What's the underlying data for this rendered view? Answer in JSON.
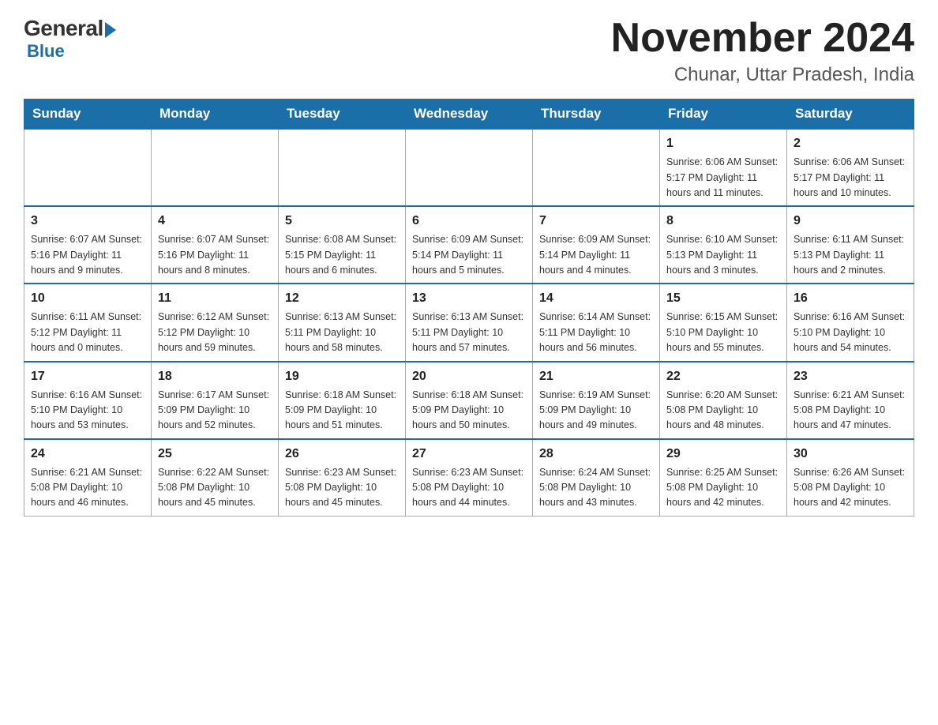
{
  "header": {
    "logo_general": "General",
    "logo_blue": "Blue",
    "month_title": "November 2024",
    "location": "Chunar, Uttar Pradesh, India"
  },
  "days_of_week": [
    "Sunday",
    "Monday",
    "Tuesday",
    "Wednesday",
    "Thursday",
    "Friday",
    "Saturday"
  ],
  "weeks": [
    [
      {
        "day": "",
        "info": ""
      },
      {
        "day": "",
        "info": ""
      },
      {
        "day": "",
        "info": ""
      },
      {
        "day": "",
        "info": ""
      },
      {
        "day": "",
        "info": ""
      },
      {
        "day": "1",
        "info": "Sunrise: 6:06 AM\nSunset: 5:17 PM\nDaylight: 11 hours\nand 11 minutes."
      },
      {
        "day": "2",
        "info": "Sunrise: 6:06 AM\nSunset: 5:17 PM\nDaylight: 11 hours\nand 10 minutes."
      }
    ],
    [
      {
        "day": "3",
        "info": "Sunrise: 6:07 AM\nSunset: 5:16 PM\nDaylight: 11 hours\nand 9 minutes."
      },
      {
        "day": "4",
        "info": "Sunrise: 6:07 AM\nSunset: 5:16 PM\nDaylight: 11 hours\nand 8 minutes."
      },
      {
        "day": "5",
        "info": "Sunrise: 6:08 AM\nSunset: 5:15 PM\nDaylight: 11 hours\nand 6 minutes."
      },
      {
        "day": "6",
        "info": "Sunrise: 6:09 AM\nSunset: 5:14 PM\nDaylight: 11 hours\nand 5 minutes."
      },
      {
        "day": "7",
        "info": "Sunrise: 6:09 AM\nSunset: 5:14 PM\nDaylight: 11 hours\nand 4 minutes."
      },
      {
        "day": "8",
        "info": "Sunrise: 6:10 AM\nSunset: 5:13 PM\nDaylight: 11 hours\nand 3 minutes."
      },
      {
        "day": "9",
        "info": "Sunrise: 6:11 AM\nSunset: 5:13 PM\nDaylight: 11 hours\nand 2 minutes."
      }
    ],
    [
      {
        "day": "10",
        "info": "Sunrise: 6:11 AM\nSunset: 5:12 PM\nDaylight: 11 hours\nand 0 minutes."
      },
      {
        "day": "11",
        "info": "Sunrise: 6:12 AM\nSunset: 5:12 PM\nDaylight: 10 hours\nand 59 minutes."
      },
      {
        "day": "12",
        "info": "Sunrise: 6:13 AM\nSunset: 5:11 PM\nDaylight: 10 hours\nand 58 minutes."
      },
      {
        "day": "13",
        "info": "Sunrise: 6:13 AM\nSunset: 5:11 PM\nDaylight: 10 hours\nand 57 minutes."
      },
      {
        "day": "14",
        "info": "Sunrise: 6:14 AM\nSunset: 5:11 PM\nDaylight: 10 hours\nand 56 minutes."
      },
      {
        "day": "15",
        "info": "Sunrise: 6:15 AM\nSunset: 5:10 PM\nDaylight: 10 hours\nand 55 minutes."
      },
      {
        "day": "16",
        "info": "Sunrise: 6:16 AM\nSunset: 5:10 PM\nDaylight: 10 hours\nand 54 minutes."
      }
    ],
    [
      {
        "day": "17",
        "info": "Sunrise: 6:16 AM\nSunset: 5:10 PM\nDaylight: 10 hours\nand 53 minutes."
      },
      {
        "day": "18",
        "info": "Sunrise: 6:17 AM\nSunset: 5:09 PM\nDaylight: 10 hours\nand 52 minutes."
      },
      {
        "day": "19",
        "info": "Sunrise: 6:18 AM\nSunset: 5:09 PM\nDaylight: 10 hours\nand 51 minutes."
      },
      {
        "day": "20",
        "info": "Sunrise: 6:18 AM\nSunset: 5:09 PM\nDaylight: 10 hours\nand 50 minutes."
      },
      {
        "day": "21",
        "info": "Sunrise: 6:19 AM\nSunset: 5:09 PM\nDaylight: 10 hours\nand 49 minutes."
      },
      {
        "day": "22",
        "info": "Sunrise: 6:20 AM\nSunset: 5:08 PM\nDaylight: 10 hours\nand 48 minutes."
      },
      {
        "day": "23",
        "info": "Sunrise: 6:21 AM\nSunset: 5:08 PM\nDaylight: 10 hours\nand 47 minutes."
      }
    ],
    [
      {
        "day": "24",
        "info": "Sunrise: 6:21 AM\nSunset: 5:08 PM\nDaylight: 10 hours\nand 46 minutes."
      },
      {
        "day": "25",
        "info": "Sunrise: 6:22 AM\nSunset: 5:08 PM\nDaylight: 10 hours\nand 45 minutes."
      },
      {
        "day": "26",
        "info": "Sunrise: 6:23 AM\nSunset: 5:08 PM\nDaylight: 10 hours\nand 45 minutes."
      },
      {
        "day": "27",
        "info": "Sunrise: 6:23 AM\nSunset: 5:08 PM\nDaylight: 10 hours\nand 44 minutes."
      },
      {
        "day": "28",
        "info": "Sunrise: 6:24 AM\nSunset: 5:08 PM\nDaylight: 10 hours\nand 43 minutes."
      },
      {
        "day": "29",
        "info": "Sunrise: 6:25 AM\nSunset: 5:08 PM\nDaylight: 10 hours\nand 42 minutes."
      },
      {
        "day": "30",
        "info": "Sunrise: 6:26 AM\nSunset: 5:08 PM\nDaylight: 10 hours\nand 42 minutes."
      }
    ]
  ]
}
